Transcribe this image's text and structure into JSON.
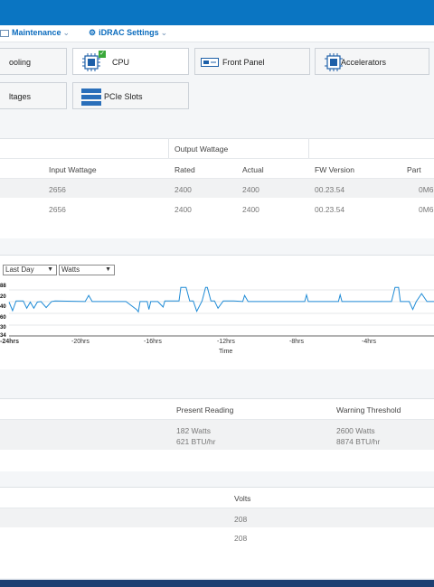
{
  "nav": {
    "maintenance": "Maintenance",
    "idrac_settings": "iDRAC Settings"
  },
  "tiles": {
    "cooling": "ooling",
    "cpu": "CPU",
    "front_panel": "Front Panel",
    "accelerators": "Accelerators",
    "voltages": "ltages",
    "pcie_slots": "PCIe Slots"
  },
  "psu_table": {
    "group_header": "Output Wattage",
    "columns": {
      "input_wattage": "Input Wattage",
      "rated": "Rated",
      "actual": "Actual",
      "fw_version": "FW Version",
      "part": "Part"
    },
    "rows": [
      {
        "input_wattage": "2656",
        "rated": "2400",
        "actual": "2400",
        "fw_version": "00.23.54",
        "part": "0M6"
      },
      {
        "input_wattage": "2656",
        "rated": "2400",
        "actual": "2400",
        "fw_version": "00.23.54",
        "part": "0M6"
      }
    ]
  },
  "chart_controls": {
    "range_selected": "Last Day",
    "unit_selected": "Watts"
  },
  "chart_data": {
    "type": "line",
    "xlabel": "Time",
    "ylabel": "",
    "x_ticks": [
      "-24hrs",
      "-20hrs",
      "-16hrs",
      "-12hrs",
      "-8hrs",
      "-4hrs"
    ],
    "y_ticks": [
      "88",
      "20",
      "40",
      "60",
      "30",
      "34"
    ],
    "xlim": [
      -24,
      0
    ],
    "ylim": [
      180,
      188
    ],
    "series": [
      {
        "x": [
          -24,
          -23.8,
          -23.6,
          -23.2,
          -23.0,
          -22.8,
          -22.6,
          -22.4,
          -22.2,
          -21.9,
          -21.6,
          -21.4,
          -19.7,
          -19.5,
          -19.3,
          -17.4,
          -16.8,
          -16.7,
          -16.6,
          -16.2,
          -16.1,
          -16.0,
          -15.6,
          -15.3,
          -15.2,
          -15.1,
          -14.4,
          -14.3,
          -14.0,
          -13.8,
          -13.6,
          -13.4,
          -13.1,
          -12.9,
          -12.8,
          -12.6,
          -12.4,
          -12.2,
          -11.9,
          -11.6,
          -11.3,
          -10.8,
          -10.7,
          -10.5,
          -7.3,
          -7.2,
          -7.1,
          -5.4,
          -5.3,
          -5.2,
          -2.4,
          -2.2,
          -2.0,
          -1.9,
          -1.4,
          -1.2,
          -1.0,
          -0.7,
          -0.4,
          0
        ],
        "y": [
          185.4,
          184.0,
          185.6,
          185.6,
          184.4,
          185.4,
          184.4,
          185.4,
          185.5,
          184.5,
          185.5,
          185.6,
          185.5,
          186.5,
          185.5,
          185.5,
          184.2,
          183.8,
          185.5,
          185.5,
          184.2,
          185.5,
          185.5,
          184.6,
          185.6,
          185.6,
          185.6,
          187.8,
          187.8,
          185.6,
          185.6,
          183.9,
          185.6,
          187.8,
          187.8,
          185.6,
          185.6,
          184.4,
          185.6,
          185.6,
          185.6,
          185.5,
          186.5,
          185.5,
          185.5,
          186.6,
          185.5,
          185.5,
          186.6,
          185.5,
          185.5,
          187.8,
          187.8,
          185.5,
          185.5,
          184.2,
          185.5,
          186.8,
          185.5,
          185.5
        ]
      }
    ]
  },
  "power_reading": {
    "present_header": "Present Reading",
    "warning_header": "Warning Threshold",
    "present_watts": "182 Watts",
    "present_btu": "621 BTU/hr",
    "warning_watts": "2600 Watts",
    "warning_btu": "8874 BTU/hr"
  },
  "voltage_table": {
    "header": "Volts",
    "rows": [
      "208",
      "208"
    ]
  },
  "colors": {
    "brand_blue": "#0a75c2",
    "chart_line": "#1f8bd6"
  }
}
